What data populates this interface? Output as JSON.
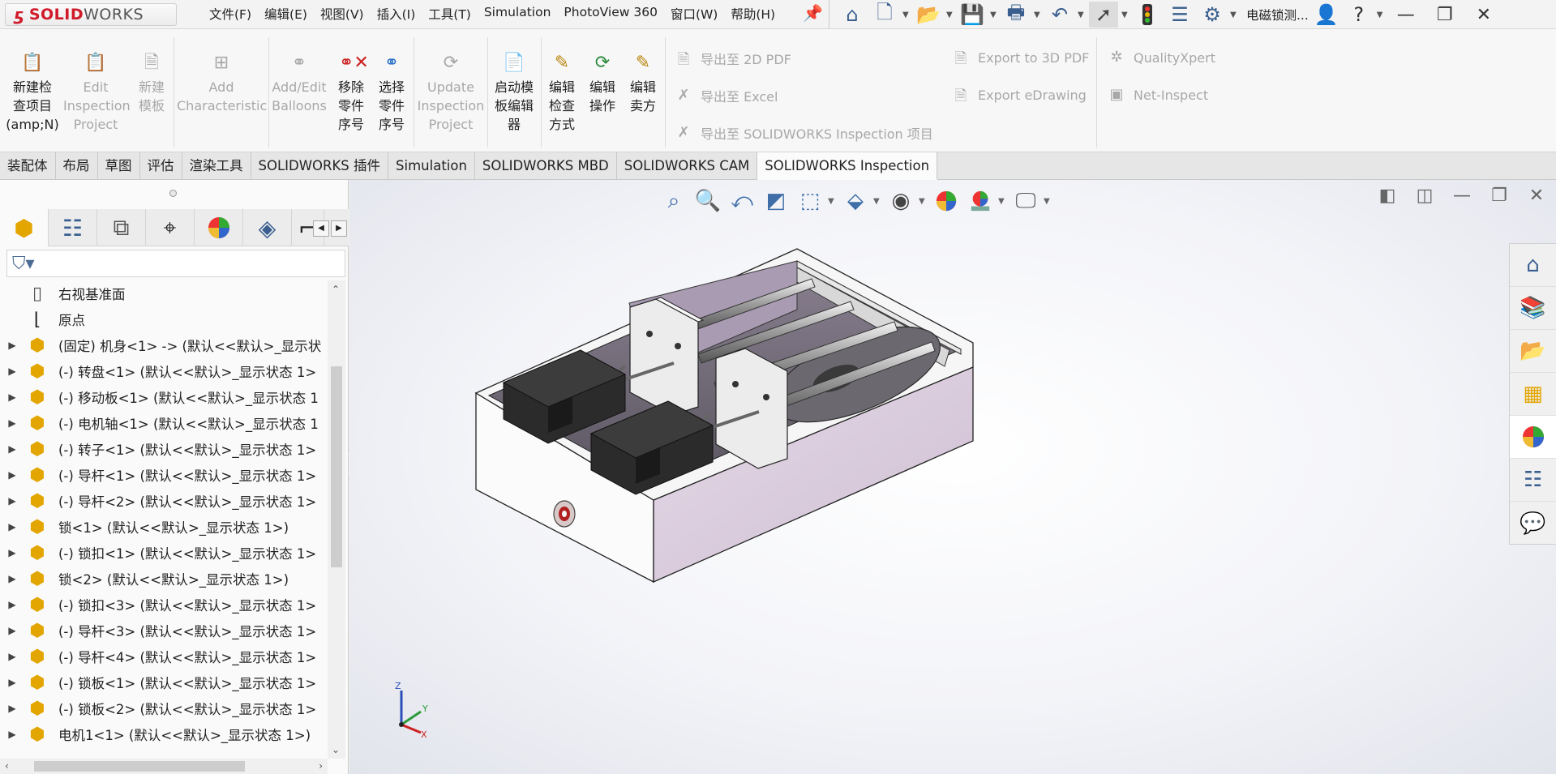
{
  "app": {
    "logo_ds": "ƽ",
    "logo_text_a": "SOLID",
    "logo_text_b": "WORKS",
    "document_name": "电磁锁测..."
  },
  "menu": [
    "文件(F)",
    "编辑(E)",
    "视图(V)",
    "插入(I)",
    "工具(T)",
    "Simulation",
    "PhotoView 360",
    "窗口(W)",
    "帮助(H)"
  ],
  "toolbar_icons": [
    "home-icon",
    "new-document-icon",
    "open-icon",
    "save-icon",
    "print-icon",
    "undo-icon",
    "select-icon",
    "traffic-light-icon",
    "file-properties-icon",
    "options-gear-icon",
    "user-icon",
    "help-icon"
  ],
  "commands": {
    "new_project": [
      "新建检",
      "查项目",
      "(amp;N)"
    ],
    "edit_project": [
      "Edit",
      "Inspection",
      "Project"
    ],
    "new_template": [
      "新建",
      "模板"
    ],
    "add_characteristic": [
      "Add",
      "Characteristic"
    ],
    "add_balloons": [
      "Add/Edit",
      "Balloons"
    ],
    "remove_part_number": [
      "移除",
      "零件",
      "序号"
    ],
    "select_part_number": [
      "选择",
      "零件",
      "序号"
    ],
    "update_project": [
      "Update",
      "Inspection",
      "Project"
    ],
    "launch_template_editor": [
      "启动模",
      "板编辑",
      "器"
    ],
    "edit_inspection_method": [
      "编辑",
      "检查",
      "方式"
    ],
    "edit_operation": [
      "编辑",
      "操作"
    ],
    "edit_vendor": [
      "编辑",
      "卖方"
    ]
  },
  "exports": {
    "pdf2d": "导出至 2D PDF",
    "excel": "导出至 Excel",
    "sw_inspection": "导出至 SOLIDWORKS Inspection 项目",
    "pdf3d": "Export to 3D PDF",
    "edrawing": "Export eDrawing",
    "qualityxpert": "QualityXpert",
    "net_inspect": "Net-Inspect"
  },
  "tabs": [
    "装配体",
    "布局",
    "草图",
    "评估",
    "渲染工具",
    "SOLIDWORKS 插件",
    "Simulation",
    "SOLIDWORKS MBD",
    "SOLIDWORKS CAM",
    "SOLIDWORKS Inspection"
  ],
  "active_tab": "SOLIDWORKS Inspection",
  "tree": [
    {
      "label": "右视基准面",
      "type": "plane",
      "expandable": false
    },
    {
      "label": "原点",
      "type": "origin",
      "expandable": false
    },
    {
      "label": "(固定) 机身<1> -> (默认<<默认>_显示状",
      "type": "part",
      "expandable": true
    },
    {
      "label": "(-) 转盘<1> (默认<<默认>_显示状态 1>",
      "type": "part",
      "expandable": true
    },
    {
      "label": "(-) 移动板<1> (默认<<默认>_显示状态 1",
      "type": "part",
      "expandable": true
    },
    {
      "label": "(-) 电机轴<1> (默认<<默认>_显示状态 1",
      "type": "part",
      "expandable": true
    },
    {
      "label": "(-) 转子<1> (默认<<默认>_显示状态 1>",
      "type": "part",
      "expandable": true
    },
    {
      "label": "(-) 导杆<1> (默认<<默认>_显示状态 1>",
      "type": "part",
      "expandable": true
    },
    {
      "label": "(-) 导杆<2> (默认<<默认>_显示状态 1>",
      "type": "part",
      "expandable": true
    },
    {
      "label": "锁<1> (默认<<默认>_显示状态 1>)",
      "type": "part",
      "expandable": true
    },
    {
      "label": "(-) 锁扣<1> (默认<<默认>_显示状态 1>",
      "type": "part",
      "expandable": true
    },
    {
      "label": "锁<2> (默认<<默认>_显示状态 1>)",
      "type": "part",
      "expandable": true
    },
    {
      "label": "(-) 锁扣<3> (默认<<默认>_显示状态 1>",
      "type": "part",
      "expandable": true
    },
    {
      "label": "(-) 导杆<3> (默认<<默认>_显示状态 1>",
      "type": "part",
      "expandable": true
    },
    {
      "label": "(-) 导杆<4> (默认<<默认>_显示状态 1>",
      "type": "part",
      "expandable": true
    },
    {
      "label": "(-) 锁板<1> (默认<<默认>_显示状态 1>",
      "type": "part",
      "expandable": true
    },
    {
      "label": "(-) 锁板<2> (默认<<默认>_显示状态 1>",
      "type": "part",
      "expandable": true
    },
    {
      "label": "电机1<1> (默认<<默认>_显示状态 1>)",
      "type": "part",
      "expandable": true
    }
  ],
  "triad": {
    "x": "X",
    "y": "Y",
    "z": "Z"
  },
  "colors": {
    "accent": "#2a72c8",
    "brand": "#d11a2a",
    "model_box": "#f4f4f6",
    "model_side": "#d9cddc",
    "part_icon": "#e3a500"
  }
}
